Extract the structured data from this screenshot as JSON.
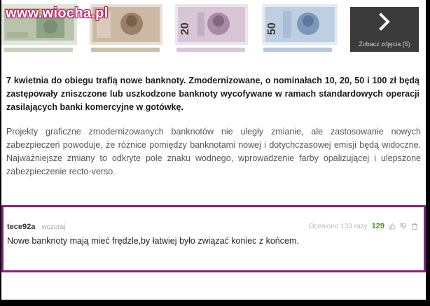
{
  "watermark": "www.wiocha.pl",
  "gallery": {
    "thumbnails": [
      {
        "name": "banknote-10",
        "denomination": "",
        "color": "#9aa58c"
      },
      {
        "name": "banknote-10-obverse",
        "denomination": "",
        "color": "#b49a82"
      },
      {
        "name": "banknote-20",
        "denomination": "20",
        "color": "#c7b2c8"
      },
      {
        "name": "banknote-50",
        "denomination": "50",
        "color": "#8fa7c9"
      }
    ],
    "next_label": "Zobacz zdjęcia (5)"
  },
  "article": {
    "lead": "7 kwietnia do obiegu trafią nowe banknoty. Zmodernizowane, o nominałach 10, 20, 50 i 100 zł będą zastępowały zniszczone lub uszkodzone banknoty wycofywane w ramach standardowych operacji zasilających banki komercyjne w gotówkę.",
    "body": "Projekty graficzne zmodernizowanych banknotów nie uległy zmianie, ale zastosowanie nowych zabezpieczeń powoduje, że różnice pomiędzy banknotami nowej i dotychczasowej emisji będą widoczne. Najważniejsze zmiany to odkryte pole znaku wodnego, wprowadzenie farby opalizującej i ulepszone zabezpieczenie recto-verso."
  },
  "comment": {
    "author": "tece92a",
    "time": "wczoraj",
    "rated_label": "Oceniono 133 razy",
    "score": "129",
    "text": "Nowe banknoty mają mieć frędzle,by łatwiej było związać koniec z końcem."
  },
  "colors": {
    "highlight_border": "#8b1f7e",
    "score_green": "#4a8f2a"
  }
}
